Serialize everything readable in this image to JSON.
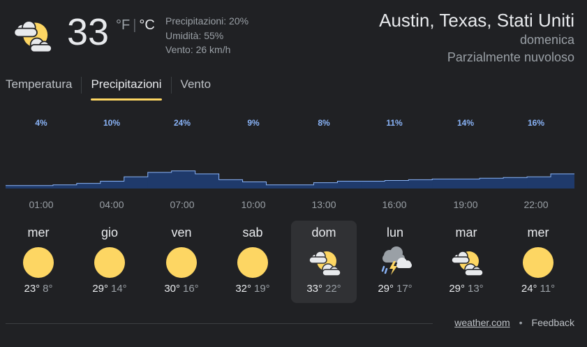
{
  "current": {
    "icon": "partly-cloudy-icon",
    "temperature": "33",
    "unit_f": "°F",
    "unit_c": "°C",
    "precipitation": "Precipitazioni: 20%",
    "humidity": "Umidità: 55%",
    "wind": "Vento: 26 km/h"
  },
  "location": {
    "name": "Austin, Texas, Stati Uniti",
    "day": "domenica",
    "condition": "Parzialmente nuvoloso"
  },
  "tabs": [
    {
      "label": "Temperatura",
      "active": false
    },
    {
      "label": "Precipitazioni",
      "active": true
    },
    {
      "label": "Vento",
      "active": false
    }
  ],
  "chart_data": {
    "type": "area",
    "labels": [
      "4%",
      "10%",
      "24%",
      "9%",
      "8%",
      "11%",
      "14%",
      "16%"
    ],
    "times": [
      "01:00",
      "04:00",
      "07:00",
      "10:00",
      "13:00",
      "16:00",
      "19:00",
      "22:00"
    ],
    "values": [
      4,
      4,
      5,
      7,
      10,
      16,
      22,
      24,
      20,
      12,
      9,
      5,
      5,
      8,
      10,
      10,
      11,
      12,
      13,
      13,
      14,
      15,
      16,
      20
    ],
    "colors": {
      "fill": "#1f3a6b",
      "line": "#8ab4f8",
      "labels": "#8ab4f8"
    }
  },
  "days": [
    {
      "name": "mer",
      "icon": "sunny-icon",
      "hi": "23°",
      "lo": "8°",
      "selected": false
    },
    {
      "name": "gio",
      "icon": "sunny-icon",
      "hi": "29°",
      "lo": "14°",
      "selected": false
    },
    {
      "name": "ven",
      "icon": "sunny-icon",
      "hi": "30°",
      "lo": "16°",
      "selected": false
    },
    {
      "name": "sab",
      "icon": "sunny-icon",
      "hi": "32°",
      "lo": "19°",
      "selected": false
    },
    {
      "name": "dom",
      "icon": "partly-cloudy-icon",
      "hi": "33°",
      "lo": "22°",
      "selected": true
    },
    {
      "name": "lun",
      "icon": "thunderstorm-icon",
      "hi": "29°",
      "lo": "17°",
      "selected": false
    },
    {
      "name": "mar",
      "icon": "partly-cloudy-icon",
      "hi": "29°",
      "lo": "13°",
      "selected": false
    },
    {
      "name": "mer",
      "icon": "sunny-icon",
      "hi": "24°",
      "lo": "11°",
      "selected": false
    }
  ],
  "footer": {
    "source": "weather.com",
    "separator": "•",
    "feedback": "Feedback"
  },
  "colors": {
    "background": "#202124",
    "accent": "#fdd663",
    "sun": "#fdd663",
    "cloud": "#e8eaed",
    "rain": "#8ab4f8"
  }
}
